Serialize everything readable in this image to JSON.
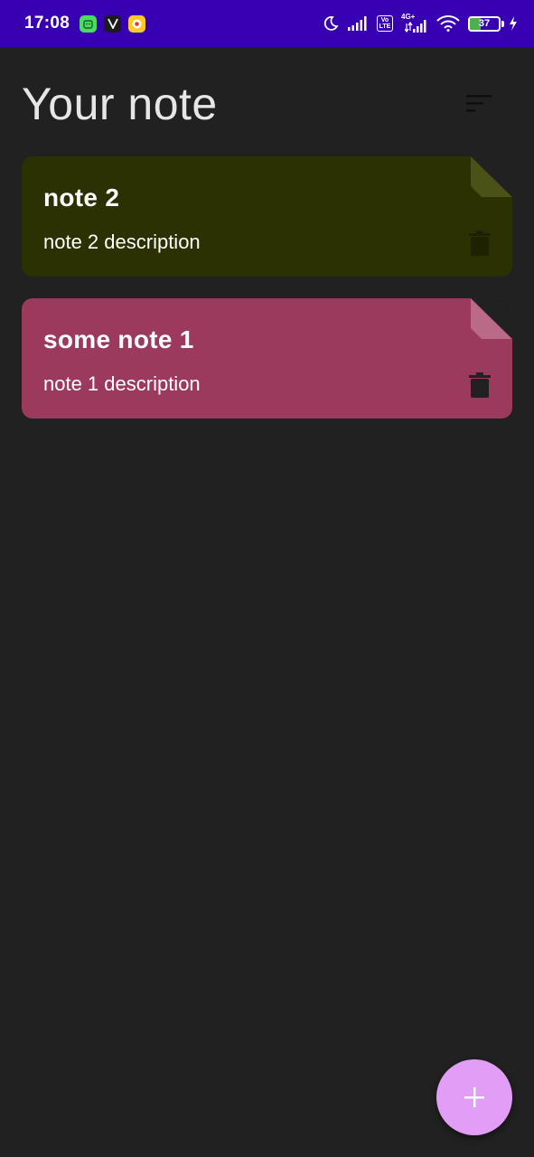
{
  "status_bar": {
    "time": "17:08",
    "battery_level": "37",
    "battery_fraction": 0.37,
    "icons": [
      "android-app-icon",
      "v-app-icon",
      "music-app-icon",
      "moon-icon",
      "signal-icon",
      "volte-icon",
      "4g-signal-icon",
      "wifi-icon",
      "battery-icon",
      "charging-icon"
    ],
    "network_4g": "4G+",
    "volte_label": "Vo LTE",
    "background_color": "#3700b3"
  },
  "header": {
    "title": "Your note",
    "sort_icon": "sort-icon"
  },
  "notes": [
    {
      "title": "note 2",
      "description": "note 2 description",
      "color": "#2b3100",
      "fold_color": "#4a5218",
      "delete_icon": "trash-icon",
      "delete_icon_color": "#1f2200"
    },
    {
      "title": "some note 1",
      "description": "note 1 description",
      "color": "#9b3a5c",
      "fold_color": "#b86a86",
      "delete_icon": "trash-icon",
      "delete_icon_color": "#212121"
    }
  ],
  "fab": {
    "icon": "plus-icon",
    "color": "#e29ef7"
  },
  "colors": {
    "background": "#212121",
    "title_text": "#e6e6e6"
  }
}
